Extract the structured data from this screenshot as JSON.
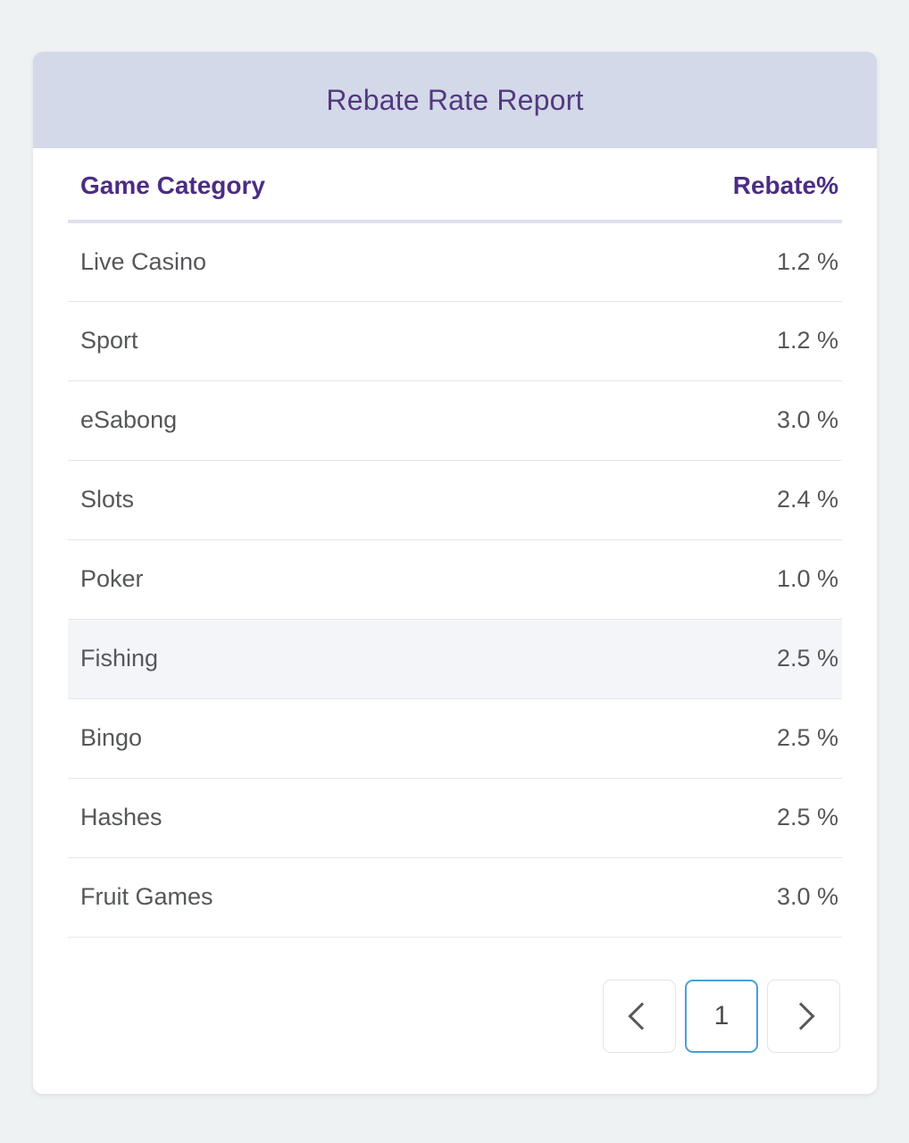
{
  "card": {
    "title": "Rebate Rate Report"
  },
  "table": {
    "columns": [
      {
        "key": "category",
        "label": "Game Category",
        "align": "left"
      },
      {
        "key": "rebate",
        "label": "Rebate%",
        "align": "right"
      }
    ],
    "rows": [
      {
        "category": "Live Casino",
        "rebate": "1.2 %",
        "highlighted": false
      },
      {
        "category": "Sport",
        "rebate": "1.2 %",
        "highlighted": false
      },
      {
        "category": "eSabong",
        "rebate": "3.0 %",
        "highlighted": false
      },
      {
        "category": "Slots",
        "rebate": "2.4 %",
        "highlighted": false
      },
      {
        "category": "Poker",
        "rebate": "1.0 %",
        "highlighted": false
      },
      {
        "category": "Fishing",
        "rebate": "2.5 %",
        "highlighted": true
      },
      {
        "category": "Bingo",
        "rebate": "2.5 %",
        "highlighted": false
      },
      {
        "category": "Hashes",
        "rebate": "2.5 %",
        "highlighted": false
      },
      {
        "category": "Fruit Games",
        "rebate": "3.0 %",
        "highlighted": false
      }
    ]
  },
  "pagination": {
    "prev_icon": "chevron-left-icon",
    "next_icon": "chevron-right-icon",
    "pages": [
      "1"
    ],
    "active_page": "1"
  },
  "colors": {
    "page_background": "#eef2f2",
    "card_header_band": "#d3d9e9",
    "card_title_text": "#53397f",
    "column_header_text": "#4b2d83",
    "header_divider": "#dde1ed",
    "row_text": "#555759",
    "row_divider": "#e6e6e8",
    "row_highlight": "#f4f5f9",
    "pagination_border": "#e2e4e6",
    "pagination_active_border": "#4a9fd5"
  }
}
